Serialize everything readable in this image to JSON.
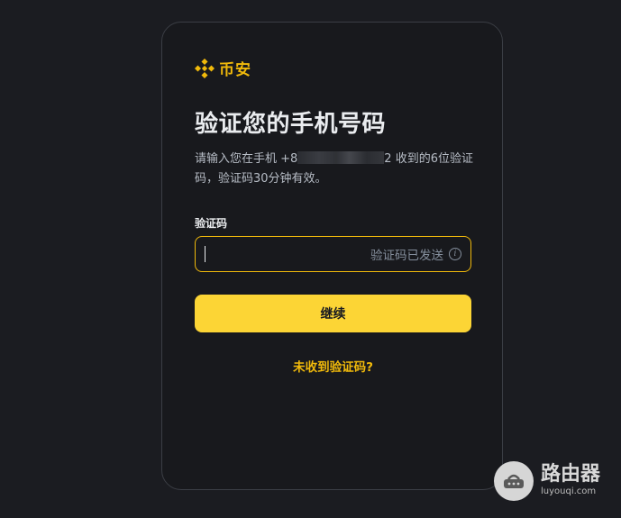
{
  "brand": {
    "name": "币安"
  },
  "title": "验证您的手机号码",
  "description": {
    "prefix": "请输入您在手机 +8",
    "suffix": "2 收到的6位验证码，验证码30分钟有效。"
  },
  "form": {
    "label": "验证码",
    "input_value": "",
    "sent_hint": "验证码已发送",
    "info_icon": "info-icon"
  },
  "buttons": {
    "continue": "继续",
    "resend": "未收到验证码?"
  },
  "watermark": {
    "main": "路由器",
    "sub": "luyouqi.com"
  },
  "colors": {
    "accent": "#f0b90b",
    "button": "#fcd535",
    "background": "#1b1c21"
  }
}
